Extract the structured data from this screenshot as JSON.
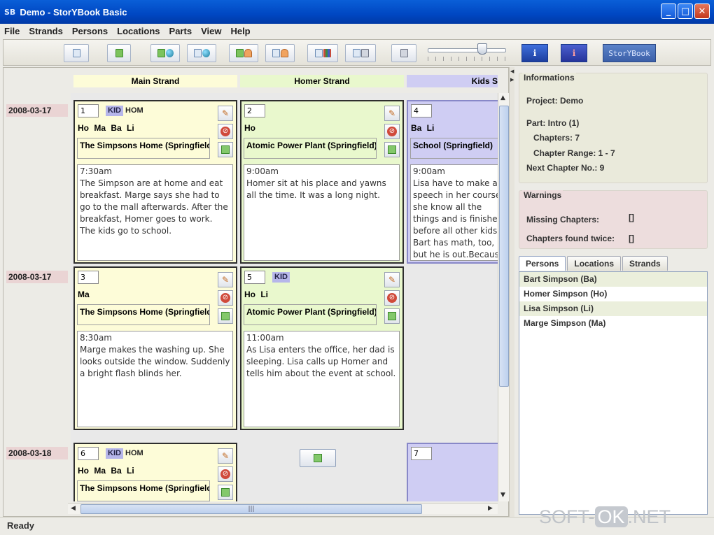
{
  "window": {
    "app_icon": "SB",
    "title": "Demo - StorYBook Basic",
    "minimize": "_",
    "maximize": "□",
    "close": "✕"
  },
  "menu": [
    "File",
    "Strands",
    "Persons",
    "Locations",
    "Parts",
    "View",
    "Help"
  ],
  "toolbar": {
    "logo_text": "StorYBook",
    "info_label": "i",
    "info2_label": "i"
  },
  "strands": [
    {
      "name": "Main Strand",
      "color": "#fdfcd8"
    },
    {
      "name": "Homer Strand",
      "color": "#e9f8cd"
    },
    {
      "name": "Kids Strand",
      "color": "#cfcdf3"
    }
  ],
  "dates": [
    "2008-03-17",
    "2008-03-17",
    "2008-03-18"
  ],
  "scenes": [
    {
      "num": "1",
      "kid": "KID",
      "hom": "HOM",
      "persons": "Ho Ma Ba Li",
      "location": "The Simpsons Home (Springfield)",
      "text": "7:30am\nThe Simpson are at home and eat breakfast. Marge says she had to go to the mall afterwards. After the breakfast, Homer goes to work. The kids go to school."
    },
    {
      "num": "2",
      "persons": "Ho",
      "location": "Atomic Power Plant (Springfield)",
      "text": "9:00am\nHomer sit at his place and yawns all the time. It was a long night."
    },
    {
      "num": "4",
      "persons": "Ba Li",
      "location": "School (Springfield)",
      "text": "9:00am\nLisa have to make a speech in her course she know all the things and is finished before all other kids.\nBart has math, too, but he is out.Because he is bored he goes to the toilet. Then he t"
    },
    {
      "num": "3",
      "persons": "Ma",
      "location": "The Simpsons Home (Springfield)",
      "text": "8:30am\nMarge makes the washing up. She looks outside the window. Suddenly a bright flash blinds her."
    },
    {
      "num": "5",
      "kid": "KID",
      "persons": "Ho Li",
      "location": "Atomic Power Plant (Springfield)",
      "text": "11:00am\nAs Lisa enters the office, her dad is sleeping. Lisa calls up Homer and tells him about the event at school."
    },
    {
      "num": "6",
      "kid": "KID",
      "hom": "HOM",
      "persons": "Ho Ma Ba Li",
      "location": "The Simpsons Home (Springfield)",
      "text": ""
    },
    {
      "num": "7"
    }
  ],
  "info": {
    "title": "Informations",
    "project": "Project: Demo",
    "part": "Part: Intro (1)",
    "chapters": "Chapters: 7",
    "chapter_range": "Chapter Range: 1 - 7",
    "next_chapter": "Next Chapter No.: 9"
  },
  "warnings": {
    "title": "Warnings",
    "missing_label": "Missing Chapters:",
    "missing_value": "[]",
    "twice_label": "Chapters found twice:",
    "twice_value": "[]"
  },
  "tabs": [
    "Persons",
    "Locations",
    "Strands"
  ],
  "persons_list": [
    "Bart Simpson (Ba)",
    "Homer Simpson (Ho)",
    "Lisa Simpson (Li)",
    "Marge Simpson (Ma)"
  ],
  "status": "Ready",
  "watermark": {
    "pre": "SOFT-",
    "ok": "OK",
    "post": ".NET"
  }
}
